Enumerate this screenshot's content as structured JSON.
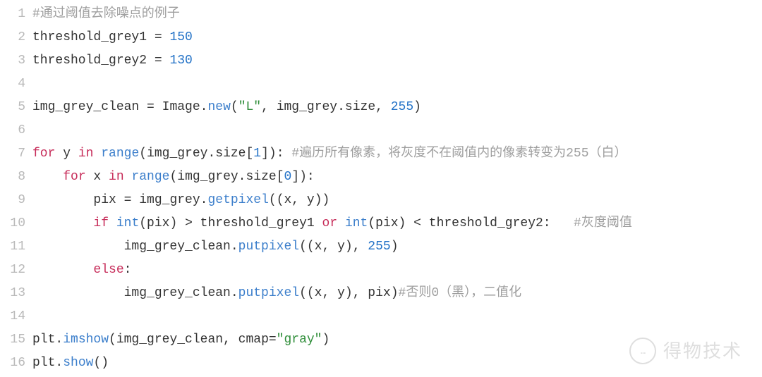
{
  "watermark": {
    "text": "得物技术"
  },
  "code": {
    "lines": [
      {
        "n": 1,
        "tokens": [
          {
            "t": "#通过阈值去除噪点的例子",
            "c": "tok-comment"
          }
        ]
      },
      {
        "n": 2,
        "tokens": [
          {
            "t": "threshold_grey1 ",
            "c": "tok-ident"
          },
          {
            "t": "=",
            "c": "tok-ident"
          },
          {
            "t": " ",
            "c": ""
          },
          {
            "t": "150",
            "c": "tok-num"
          }
        ]
      },
      {
        "n": 3,
        "tokens": [
          {
            "t": "threshold_grey2 ",
            "c": "tok-ident"
          },
          {
            "t": "=",
            "c": "tok-ident"
          },
          {
            "t": " ",
            "c": ""
          },
          {
            "t": "130",
            "c": "tok-num"
          }
        ]
      },
      {
        "n": 4,
        "tokens": [
          {
            "t": "",
            "c": ""
          }
        ]
      },
      {
        "n": 5,
        "tokens": [
          {
            "t": "img_grey_clean ",
            "c": "tok-ident"
          },
          {
            "t": "=",
            "c": "tok-ident"
          },
          {
            "t": " Image.",
            "c": "tok-ident"
          },
          {
            "t": "new",
            "c": "tok-func"
          },
          {
            "t": "(",
            "c": "tok-ident"
          },
          {
            "t": "\"L\"",
            "c": "tok-str"
          },
          {
            "t": ", img_grey.size, ",
            "c": "tok-ident"
          },
          {
            "t": "255",
            "c": "tok-num"
          },
          {
            "t": ")",
            "c": "tok-ident"
          }
        ]
      },
      {
        "n": 6,
        "tokens": [
          {
            "t": "",
            "c": ""
          }
        ]
      },
      {
        "n": 7,
        "tokens": [
          {
            "t": "for",
            "c": "tok-kw"
          },
          {
            "t": " y ",
            "c": "tok-ident"
          },
          {
            "t": "in",
            "c": "tok-kw"
          },
          {
            "t": " ",
            "c": ""
          },
          {
            "t": "range",
            "c": "tok-func"
          },
          {
            "t": "(img_grey.size[",
            "c": "tok-ident"
          },
          {
            "t": "1",
            "c": "tok-num"
          },
          {
            "t": "]): ",
            "c": "tok-ident"
          },
          {
            "t": "#遍历所有像素，将灰度不在阈值内的像素转变为255（白）",
            "c": "tok-comment"
          }
        ]
      },
      {
        "n": 8,
        "tokens": [
          {
            "t": "    ",
            "c": ""
          },
          {
            "t": "for",
            "c": "tok-kw"
          },
          {
            "t": " x ",
            "c": "tok-ident"
          },
          {
            "t": "in",
            "c": "tok-kw"
          },
          {
            "t": " ",
            "c": ""
          },
          {
            "t": "range",
            "c": "tok-func"
          },
          {
            "t": "(img_grey.size[",
            "c": "tok-ident"
          },
          {
            "t": "0",
            "c": "tok-num"
          },
          {
            "t": "]):",
            "c": "tok-ident"
          }
        ]
      },
      {
        "n": 9,
        "tokens": [
          {
            "t": "        pix ",
            "c": "tok-ident"
          },
          {
            "t": "=",
            "c": "tok-ident"
          },
          {
            "t": " img_grey.",
            "c": "tok-ident"
          },
          {
            "t": "getpixel",
            "c": "tok-func"
          },
          {
            "t": "((x, y))",
            "c": "tok-ident"
          }
        ]
      },
      {
        "n": 10,
        "tokens": [
          {
            "t": "        ",
            "c": ""
          },
          {
            "t": "if",
            "c": "tok-kw"
          },
          {
            "t": " ",
            "c": ""
          },
          {
            "t": "int",
            "c": "tok-func"
          },
          {
            "t": "(pix) ",
            "c": "tok-ident"
          },
          {
            "t": ">",
            "c": "tok-ident"
          },
          {
            "t": " threshold_grey1 ",
            "c": "tok-ident"
          },
          {
            "t": "or",
            "c": "tok-kw"
          },
          {
            "t": " ",
            "c": ""
          },
          {
            "t": "int",
            "c": "tok-func"
          },
          {
            "t": "(pix) ",
            "c": "tok-ident"
          },
          {
            "t": "<",
            "c": "tok-ident"
          },
          {
            "t": " threshold_grey2:   ",
            "c": "tok-ident"
          },
          {
            "t": "#灰度阈值",
            "c": "tok-comment"
          }
        ]
      },
      {
        "n": 11,
        "tokens": [
          {
            "t": "            img_grey_clean.",
            "c": "tok-ident"
          },
          {
            "t": "putpixel",
            "c": "tok-func"
          },
          {
            "t": "((x, y), ",
            "c": "tok-ident"
          },
          {
            "t": "255",
            "c": "tok-num"
          },
          {
            "t": ")",
            "c": "tok-ident"
          }
        ]
      },
      {
        "n": 12,
        "tokens": [
          {
            "t": "        ",
            "c": ""
          },
          {
            "t": "else",
            "c": "tok-kw"
          },
          {
            "t": ":",
            "c": "tok-ident"
          }
        ]
      },
      {
        "n": 13,
        "tokens": [
          {
            "t": "            img_grey_clean.",
            "c": "tok-ident"
          },
          {
            "t": "putpixel",
            "c": "tok-func"
          },
          {
            "t": "((x, y), pix)",
            "c": "tok-ident"
          },
          {
            "t": "#否则0（黑），二值化",
            "c": "tok-comment"
          }
        ]
      },
      {
        "n": 14,
        "tokens": [
          {
            "t": "",
            "c": ""
          }
        ]
      },
      {
        "n": 15,
        "tokens": [
          {
            "t": "plt.",
            "c": "tok-ident"
          },
          {
            "t": "imshow",
            "c": "tok-func"
          },
          {
            "t": "(img_grey_clean, cmap=",
            "c": "tok-ident"
          },
          {
            "t": "\"gray\"",
            "c": "tok-str"
          },
          {
            "t": ")",
            "c": "tok-ident"
          }
        ]
      },
      {
        "n": 16,
        "tokens": [
          {
            "t": "plt.",
            "c": "tok-ident"
          },
          {
            "t": "show",
            "c": "tok-func"
          },
          {
            "t": "()",
            "c": "tok-ident"
          }
        ]
      }
    ]
  }
}
